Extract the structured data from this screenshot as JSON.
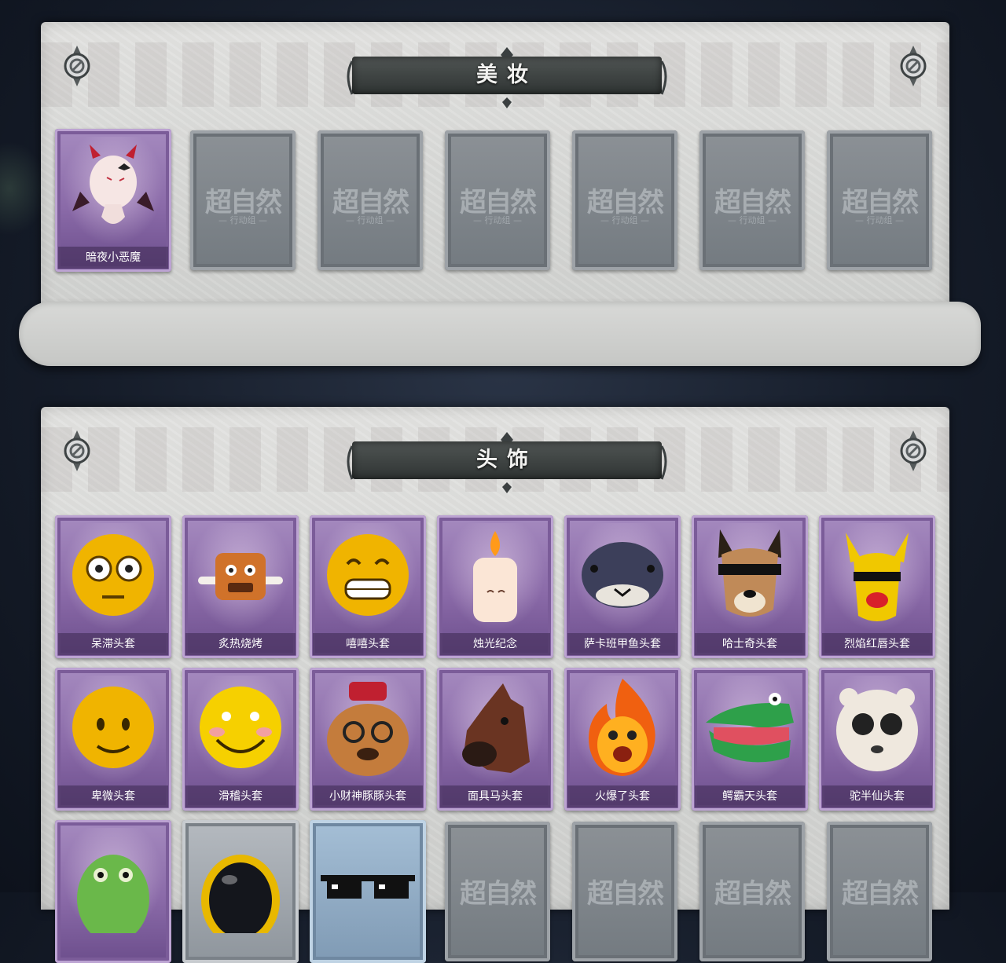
{
  "sections": {
    "makeup": {
      "title": "美妆",
      "items": [
        {
          "label": "暗夜小恶魔",
          "state": "owned",
          "icon": "devil-egg-icon"
        },
        {
          "state": "locked"
        },
        {
          "state": "locked"
        },
        {
          "state": "locked"
        },
        {
          "state": "locked"
        },
        {
          "state": "locked"
        },
        {
          "state": "locked"
        }
      ]
    },
    "headwear": {
      "title": "头饰",
      "items": [
        {
          "label": "呆滞头套",
          "icon": "dazed-emoji-icon"
        },
        {
          "label": "炙热烧烤",
          "icon": "bbq-meat-icon"
        },
        {
          "label": "嘻嘻头套",
          "icon": "grin-emoji-icon"
        },
        {
          "label": "烛光纪念",
          "icon": "candle-icon"
        },
        {
          "label": "萨卡班甲鱼头套",
          "icon": "fish-icon"
        },
        {
          "label": "哈士奇头套",
          "icon": "husky-icon"
        },
        {
          "label": "烈焰红唇头套",
          "icon": "yellow-mouse-icon"
        },
        {
          "label": "卑微头套",
          "icon": "humble-emoji-icon"
        },
        {
          "label": "滑稽头套",
          "icon": "funny-emoji-icon"
        },
        {
          "label": "小财神豚豚头套",
          "icon": "capybara-icon"
        },
        {
          "label": "面具马头套",
          "icon": "horse-mask-icon"
        },
        {
          "label": "火爆了头套",
          "icon": "fire-icon"
        },
        {
          "label": "鳄霸天头套",
          "icon": "crocodile-icon"
        },
        {
          "label": "驼半仙头套",
          "icon": "alpaca-icon"
        }
      ],
      "partial_row": [
        {
          "icon": "frog-icon",
          "card": "purple"
        },
        {
          "icon": "astronaut-helmet-icon",
          "card": "grey"
        },
        {
          "icon": "pixel-sunglasses-icon",
          "card": "blue"
        },
        {
          "card": "locked"
        },
        {
          "card": "locked"
        },
        {
          "card": "locked"
        },
        {
          "card": "locked"
        }
      ]
    }
  },
  "locked_card": {
    "logo": "超自然",
    "sub": "— 行动组 —"
  }
}
